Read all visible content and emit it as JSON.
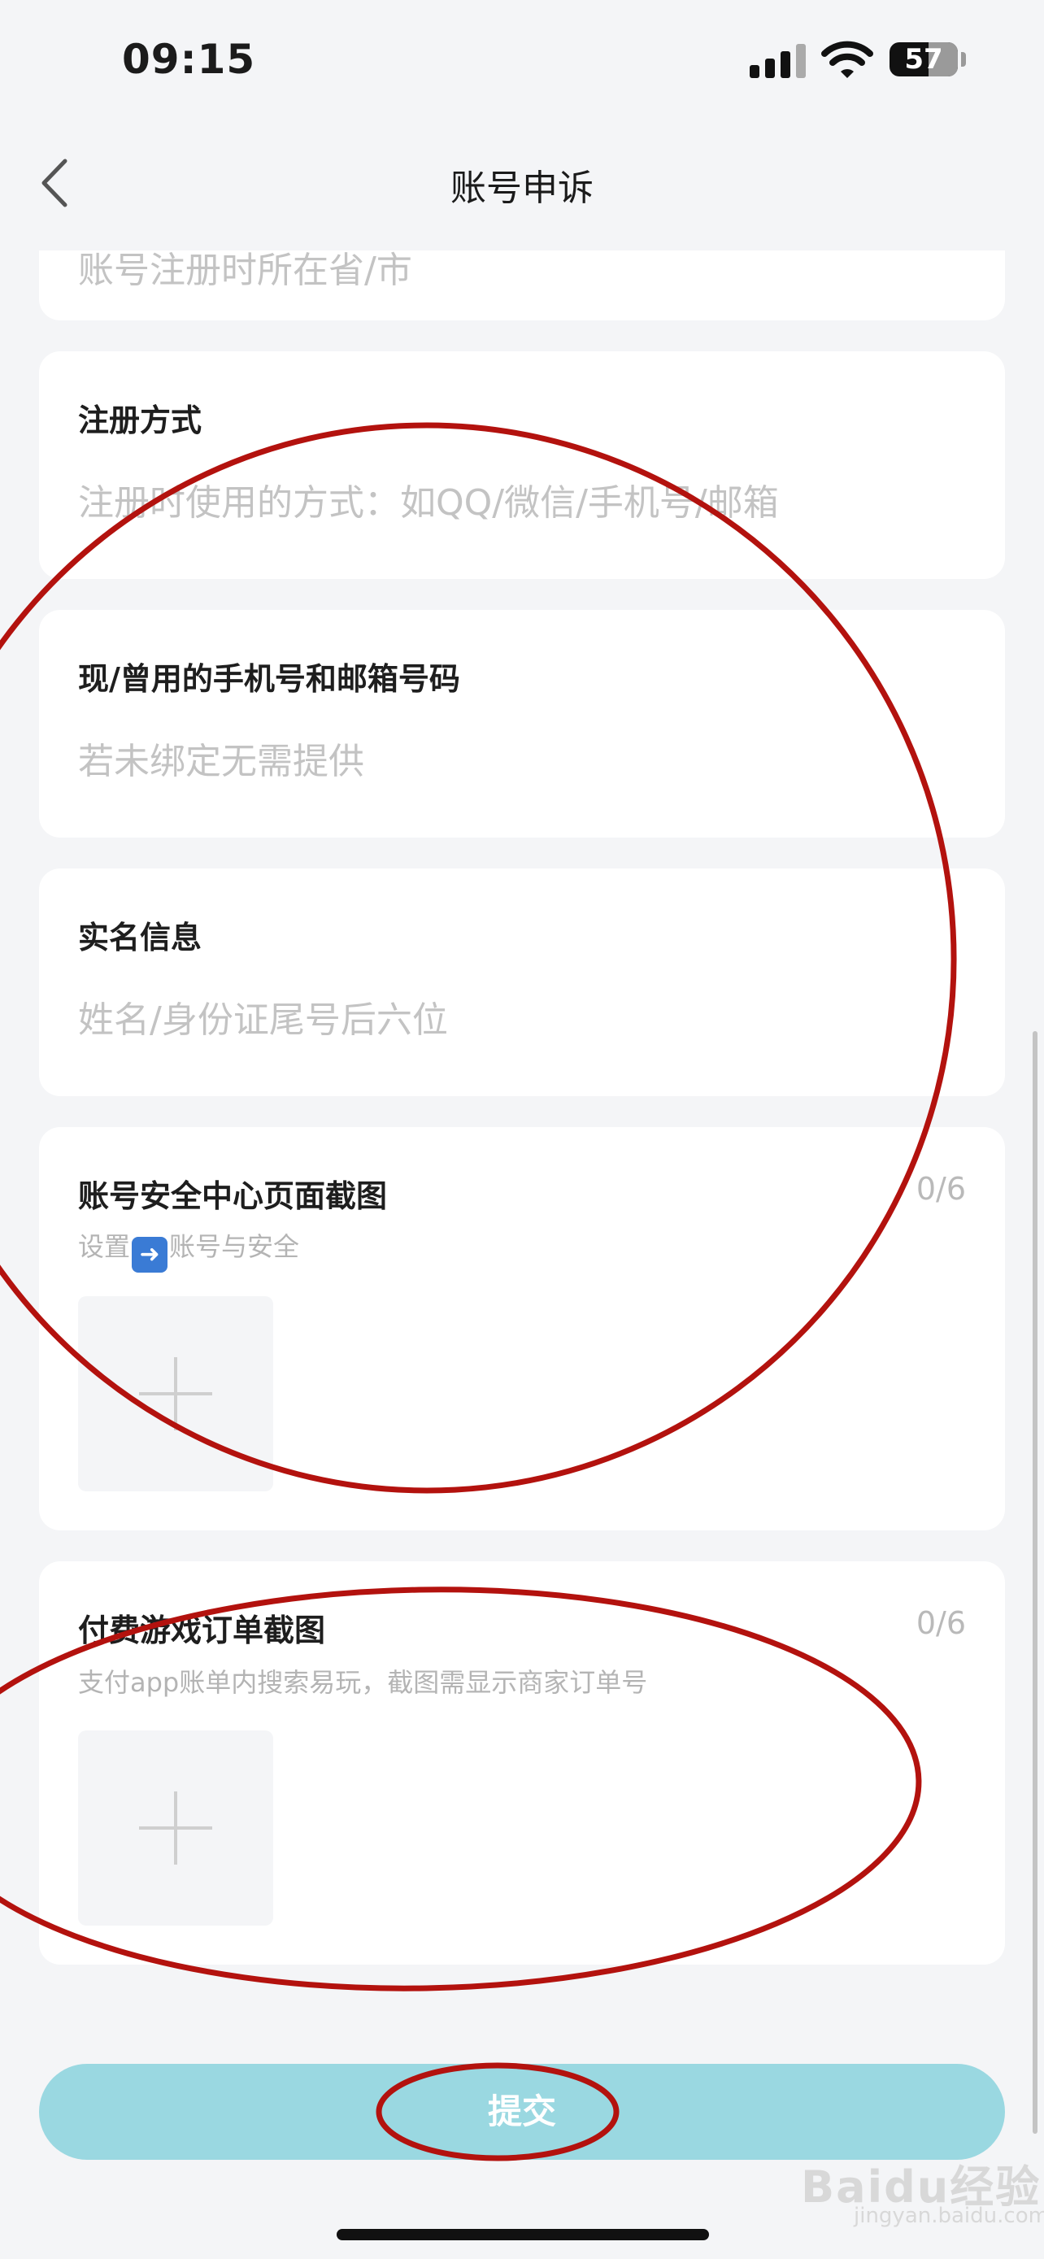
{
  "status_bar": {
    "time": "09:15",
    "battery_level": "57",
    "battery_fraction": 0.57
  },
  "nav": {
    "title": "账号申诉",
    "back_icon": "chevron-left-icon"
  },
  "form": {
    "partial_card": {
      "placeholder": "账号注册时所在省/市"
    },
    "register_method": {
      "title": "注册方式",
      "placeholder": "注册时使用的方式：如QQ/微信/手机号/邮箱"
    },
    "contact": {
      "title": "现/曾用的手机号和邮箱号码",
      "placeholder": "若未绑定无需提供"
    },
    "real_name": {
      "title": "实名信息",
      "placeholder": "姓名/身份证尾号后六位"
    },
    "security_screenshot": {
      "title": "账号安全中心页面截图",
      "counter": "0/6",
      "hint_before": "设置",
      "hint_icon": "right-arrow-emoji-icon",
      "hint_after": "账号与安全"
    },
    "order_screenshot": {
      "title": "付费游戏订单截图",
      "counter": "0/6",
      "hint": "支付app账单内搜索易玩，截图需显示商家订单号"
    }
  },
  "submit": {
    "label": "提交"
  },
  "watermark": {
    "text": "Baidu经验",
    "sub": "jingyan.baidu.com"
  },
  "colors": {
    "annotation_red": "#b3120e",
    "submit_bg": "#9ad8e1",
    "page_bg": "#f4f5f7"
  }
}
